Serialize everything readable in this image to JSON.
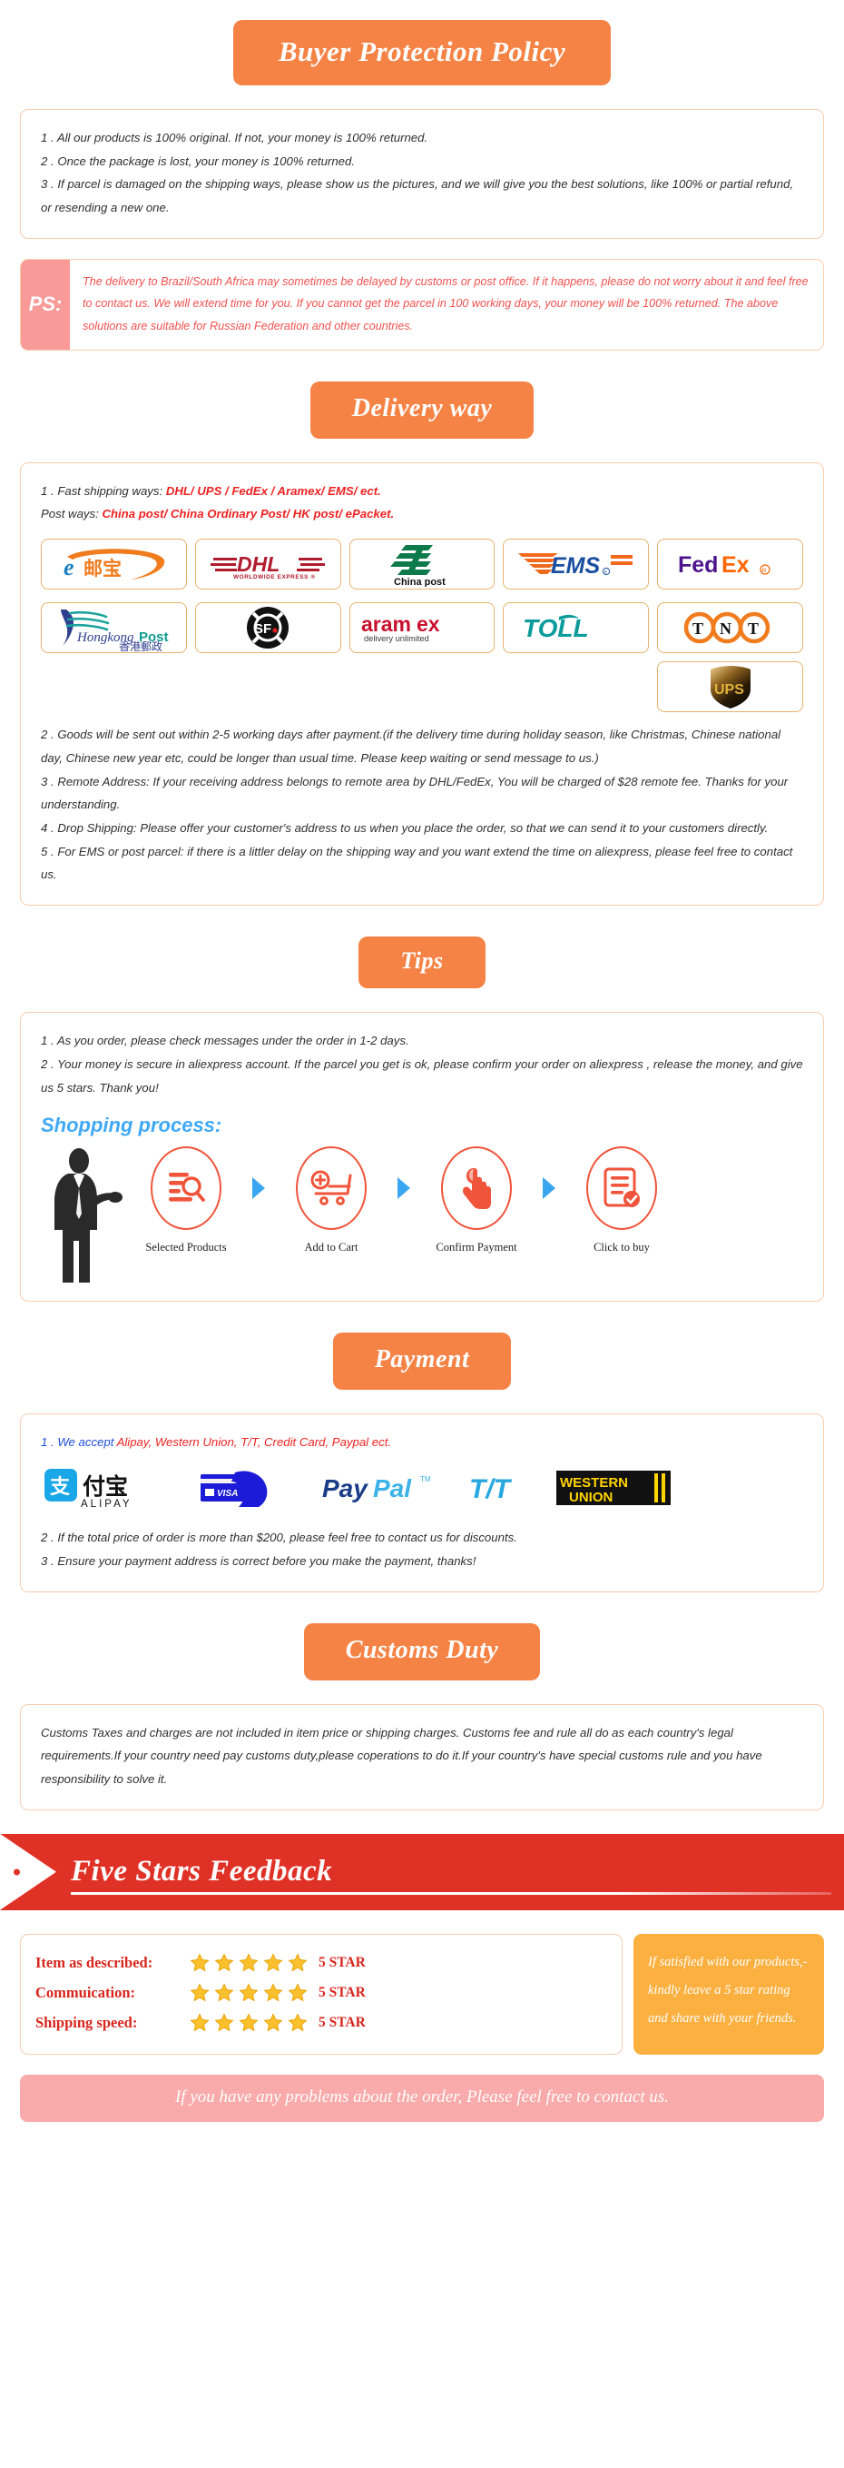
{
  "buyer_protection": {
    "heading": "Buyer Protection Policy",
    "items": [
      "1 . All our products is 100% original. If not, your money is 100% returned.",
      "2 . Once the package is lost, your money is 100% returned.",
      "3 . If parcel is damaged on the shipping ways, please show us the pictures, and we will give you the best solutions, like 100% or partial refund, or resending a new one."
    ]
  },
  "ps": {
    "label": "PS:",
    "text": "The delivery to Brazil/South Africa may sometimes be delayed by customs or post office. If it happens, please do not worry about it and feel free to contact us. We will extend time for you. If you cannot get the parcel in 100 working days, your money will be 100% returned. The above solutions are suitable for Russian Federation and other countries."
  },
  "delivery": {
    "heading": "Delivery way",
    "line1_prefix": "1 . Fast shipping ways: ",
    "line1_highlight": "DHL/ UPS / FedEx / Aramex/ EMS/ ect.",
    "line2_prefix": "Post ways: ",
    "line2_highlight": "China post/ China Ordinary Post/ HK post/ ePacket.",
    "carriers": [
      {
        "name": "epacket-logo",
        "label": "e邮宝"
      },
      {
        "name": "dhl-logo",
        "label": "DHL"
      },
      {
        "name": "china-post-logo",
        "label": "China post"
      },
      {
        "name": "ems-logo",
        "label": "EMS"
      },
      {
        "name": "fedex-logo",
        "label": "FedEx"
      },
      {
        "name": "hongkong-post-logo",
        "label": "Hongkong Post 香港郵政"
      },
      {
        "name": "sf-express-logo",
        "label": "SF"
      },
      {
        "name": "aramex-logo",
        "label": "aramex delivery unlimited"
      },
      {
        "name": "toll-logo",
        "label": "TOLL"
      },
      {
        "name": "tnt-logo",
        "label": "TNT"
      },
      {
        "name": "ups-logo",
        "label": "UPS"
      }
    ],
    "items": [
      "2 . Goods will be sent out within 2-5 working days after payment.(if the delivery time during holiday season, like Christmas, Chinese national day, Chinese new year etc, could be longer than usual time. Please keep waiting or send message to us.)",
      "3 . Remote Address: If your receiving address belongs to remote area by DHL/FedEx, You will be charged of $28 remote fee. Thanks for your understanding.",
      "4 . Drop Shipping: Please offer your customer's address to us when you place the order, so that we can send it to your customers directly.",
      "5 . For EMS or post parcel: if there is a littler delay on the shipping way and you want extend the time on aliexpress, please feel free to contact us."
    ]
  },
  "tips": {
    "heading": "Tips",
    "items": [
      "1 .  As you order, please check messages under the order in 1-2 days.",
      "2 . Your money is secure in aliexpress account. If the parcel you get is ok, please confirm your order on aliexpress , release the money, and give us 5 stars. Thank you!"
    ],
    "shopping_process_title": "Shopping process:",
    "steps": [
      {
        "icon": "search-list-icon",
        "caption": "Selected Products"
      },
      {
        "icon": "cart-plus-icon",
        "caption": "Add to Cart"
      },
      {
        "icon": "hand-click-icon",
        "caption": "Confirm Payment"
      },
      {
        "icon": "checklist-icon",
        "caption": "Click to buy"
      }
    ]
  },
  "payment": {
    "heading": "Payment",
    "line1_prefix": "1 . We accept ",
    "line1_highlight": "Alipay, Western Union, T/T, Credit Card, Paypal ect.",
    "methods": [
      {
        "name": "alipay-logo",
        "label": "支付宝 ALIPAY"
      },
      {
        "name": "visa-card-hand-logo",
        "label": "VISA"
      },
      {
        "name": "paypal-logo",
        "label": "PayPal"
      },
      {
        "name": "tt-logo",
        "label": "T/T"
      },
      {
        "name": "western-union-logo",
        "label": "WESTERN UNION"
      }
    ],
    "items": [
      "2 . If the total price of order is more than $200, please feel free to contact us for discounts.",
      "3 . Ensure your payment address is correct before you make the payment, thanks!"
    ]
  },
  "customs": {
    "heading": "Customs Duty",
    "text": "Customs Taxes and charges are not included in item price or shipping charges. Customs fee and rule all do as each country's legal requirements.If your country need pay customs duty,please coperations to do it.If your country's have special customs rule and you have responsibility to solve it."
  },
  "feedback": {
    "heading": "Five Stars Feedback",
    "rows": [
      {
        "label": "Item as described:",
        "stars": 5,
        "value": "5 STAR"
      },
      {
        "label": "Commuication:",
        "stars": 5,
        "value": "5 STAR"
      },
      {
        "label": "Shipping speed:",
        "stars": 5,
        "value": "5 STAR"
      }
    ],
    "note": "If satisfied with our products,- kindly leave a 5 star rating and share with your friends.",
    "footer": "If you have any problems about the order, Please feel free to contact us."
  },
  "colors": {
    "orange": "#f58345",
    "red": "#e03127",
    "pink": "#f79a98",
    "amber": "#fcb040",
    "blue": "#3fa9f5"
  }
}
